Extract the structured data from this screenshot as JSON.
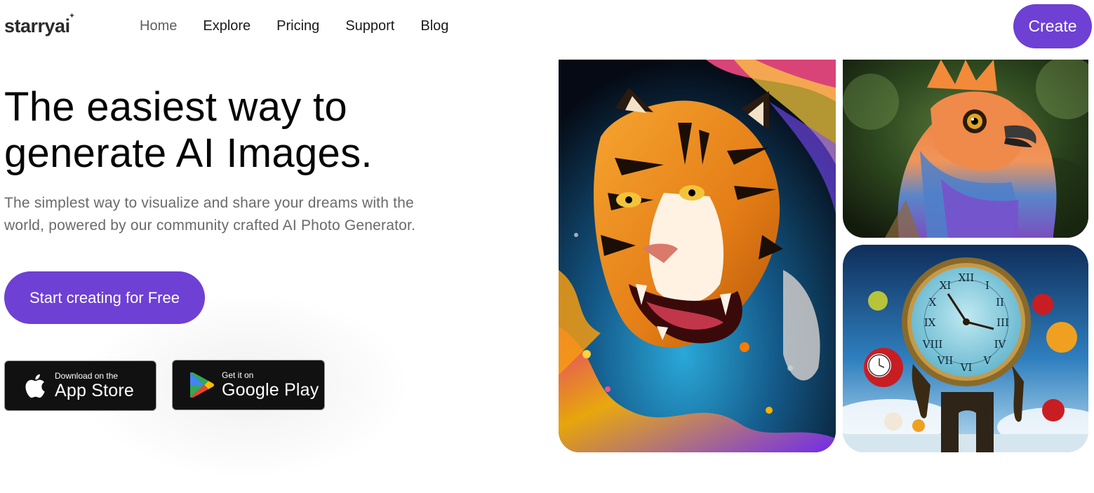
{
  "header": {
    "logo_text": "starryai",
    "logo_sparkle": "✦",
    "nav": [
      {
        "label": "Home",
        "active": true
      },
      {
        "label": "Explore"
      },
      {
        "label": "Pricing"
      },
      {
        "label": "Support"
      },
      {
        "label": "Blog"
      }
    ],
    "create_label": "Create"
  },
  "hero": {
    "headline_line1": "The easiest way to",
    "headline_line2": "generate AI Images.",
    "subtext_line1": "The simplest way to visualize and share your dreams with the",
    "subtext_line2": "world, powered by our community crafted AI Photo Generator.",
    "cta_label": "Start creating for Free"
  },
  "badges": {
    "apple": {
      "small": "Download on the",
      "big": "App Store",
      "icon": "apple-icon"
    },
    "google": {
      "small": "Get it on",
      "big": "Google Play",
      "icon": "google-play-icon"
    }
  },
  "gallery": [
    {
      "name": "tiger-artwork"
    },
    {
      "name": "bird-artwork"
    },
    {
      "name": "melting-clock-artwork"
    }
  ],
  "colors": {
    "accent": "#6e40d4",
    "text": "#0a0a0a",
    "muted": "#6a6a6a",
    "badge_bg": "#111111"
  }
}
